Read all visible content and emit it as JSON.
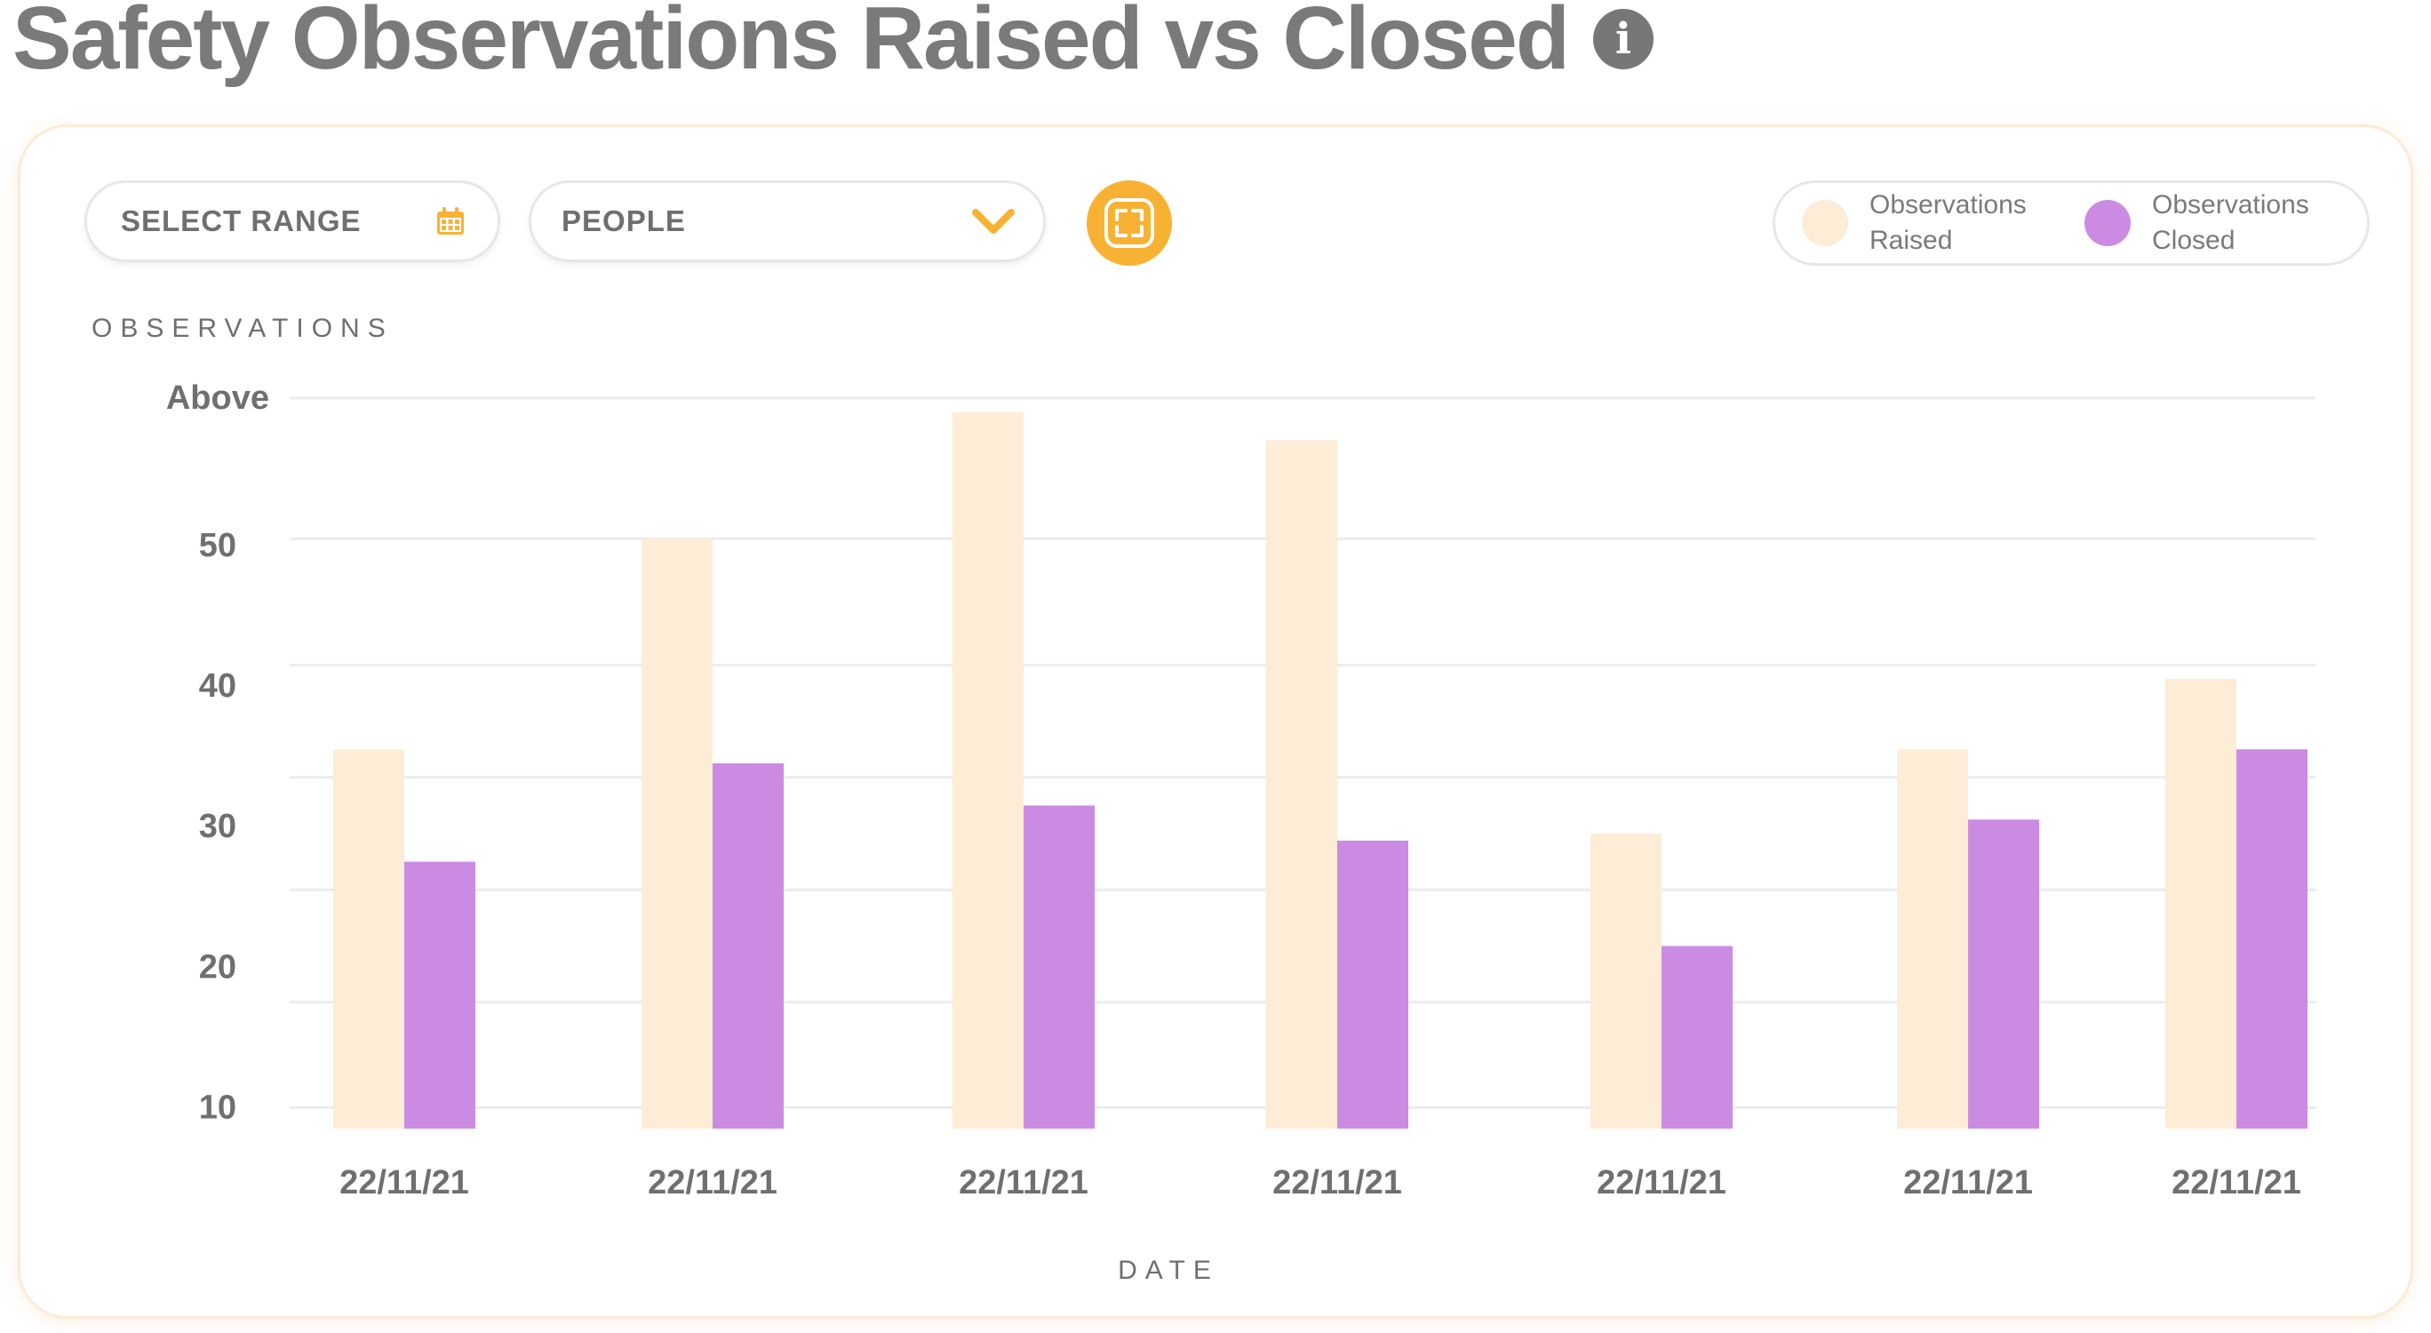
{
  "header": {
    "title": "Safety Observations Raised vs Closed",
    "info_icon": "info-icon"
  },
  "controls": {
    "range_label": "SELECT RANGE",
    "range_icon": "calendar-icon",
    "people_label": "PEOPLE",
    "people_icon": "chevron-down-icon",
    "fullscreen_icon": "fullscreen-icon",
    "accent_color": "#f8b233"
  },
  "legend": {
    "items": [
      {
        "label": "Observations Raised",
        "color": "#fdecd6"
      },
      {
        "label": "Observations Closed",
        "color": "#cc8be3"
      }
    ]
  },
  "chart_data": {
    "type": "bar",
    "ylabel": "OBSERVATIONS",
    "xlabel": "DATE",
    "categories": [
      "22/11/21",
      "22/11/21",
      "22/11/21",
      "22/11/21",
      "22/11/21",
      "22/11/21",
      "22/11/21"
    ],
    "series": [
      {
        "name": "Observations Raised",
        "color": "#fdecd6",
        "values": [
          35,
          50,
          59,
          57,
          29,
          35,
          40
        ]
      },
      {
        "name": "Observations Closed",
        "color": "#cc8be3",
        "values": [
          27,
          34,
          31,
          28.5,
          21,
          30,
          35
        ]
      }
    ],
    "y_ticks": [
      {
        "label": "10",
        "value": 10
      },
      {
        "label": "20",
        "value": 20
      },
      {
        "label": "30",
        "value": 30
      },
      {
        "label": "40",
        "value": 40
      },
      {
        "label": "50",
        "value": 50
      },
      {
        "label": "Above",
        "value": 60
      }
    ],
    "ylim": [
      8,
      60
    ],
    "grid": true,
    "legend_position": "top-right"
  }
}
